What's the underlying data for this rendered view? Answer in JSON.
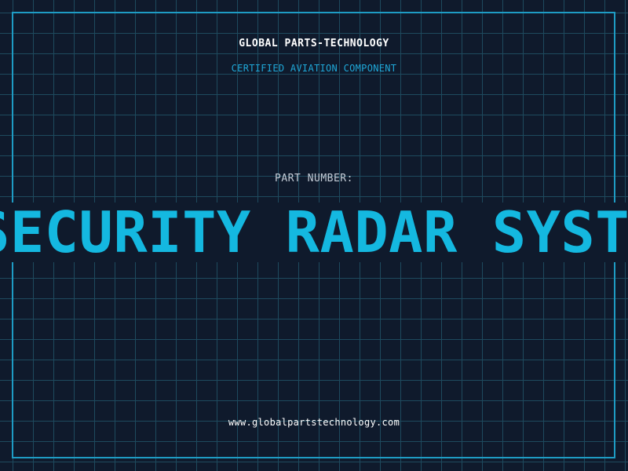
{
  "header": {
    "company": "GLOBAL PARTS-TECHNOLOGY",
    "subtitle": "CERTIFIED AVIATION COMPONENT"
  },
  "part": {
    "label": "PART NUMBER:",
    "value": "SECURITY RADAR SYSTEM"
  },
  "footer": {
    "website": "www.globalpartstechnology.com"
  },
  "colors": {
    "background": "#0f1a2c",
    "grid": "#1e4a5e",
    "frame": "#1e9cc4",
    "accent": "#14b8e0",
    "subtitle": "#1fa8d8",
    "text": "#ffffff"
  }
}
